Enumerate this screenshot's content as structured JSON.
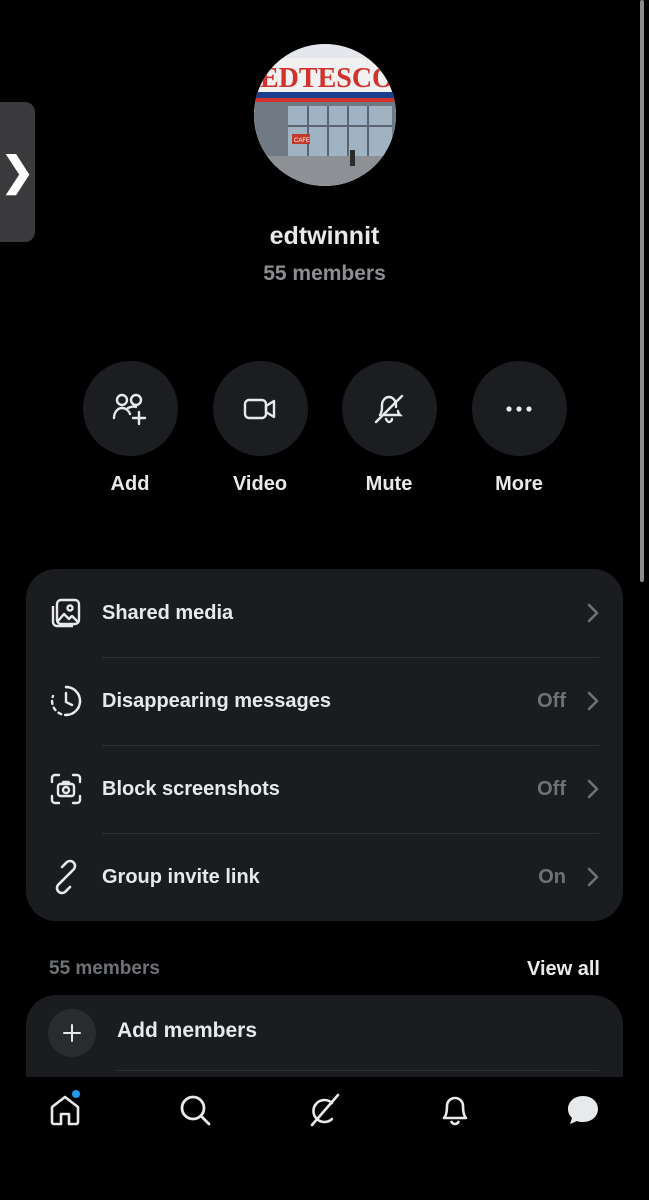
{
  "group": {
    "name": "edtwinnit",
    "member_count": "55 members",
    "avatar_text": "EDTESCO",
    "avatar_sign": "CAFE"
  },
  "actions": [
    {
      "label": "Add",
      "icon": "add-people-icon"
    },
    {
      "label": "Video",
      "icon": "video-camera-icon"
    },
    {
      "label": "Mute",
      "icon": "bell-off-icon"
    },
    {
      "label": "More",
      "icon": "more-dots-icon"
    }
  ],
  "settings": [
    {
      "label": "Shared media",
      "value": "",
      "icon": "shared-media-icon"
    },
    {
      "label": "Disappearing messages",
      "value": "Off",
      "icon": "timer-icon"
    },
    {
      "label": "Block screenshots",
      "value": "Off",
      "icon": "screenshot-icon"
    },
    {
      "label": "Group invite link",
      "value": "On",
      "icon": "link-icon"
    }
  ],
  "members": {
    "heading": "55 members",
    "view_all": "View all",
    "add_label": "Add members"
  },
  "side_tab": {
    "glyph": "❯"
  },
  "nav": [
    {
      "name": "home",
      "icon": "home-icon",
      "has_notification_dot": true
    },
    {
      "name": "search",
      "icon": "search-icon"
    },
    {
      "name": "grok",
      "icon": "grok-icon"
    },
    {
      "name": "notifications",
      "icon": "bell-icon"
    },
    {
      "name": "messages",
      "icon": "chat-bubble-icon",
      "active": true
    }
  ],
  "colors": {
    "background": "#000000",
    "card": "#1b1c1f",
    "action_circle": "#1c1d20",
    "text_primary": "#e7e9ea",
    "text_secondary": "#6e7175",
    "accent_dot": "#1d9bf0"
  }
}
